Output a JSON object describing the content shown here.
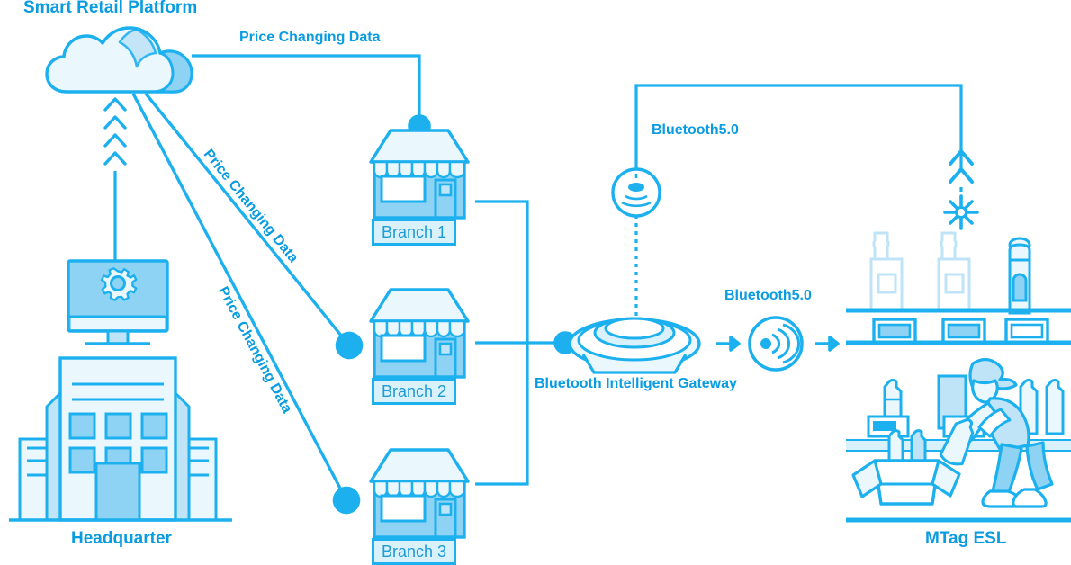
{
  "diagram": {
    "title": "Smart Retail Platform",
    "colors": {
      "accent": "#0a9ce0",
      "stroke": "#1cb0ef",
      "fill_light": "#eaf7fc",
      "fill_mid": "#bfe4f7",
      "fill_deep": "#8fd3f4",
      "label_text": "#1e9ad6",
      "label_bg": "#d8f1fb",
      "background": "#ffffff"
    },
    "nodes": {
      "cloud": {
        "label": "Smart Retail Platform",
        "icon": "cloud-icon"
      },
      "headquarter": {
        "label": "Headquarter",
        "icon": "office-building-icon",
        "monitor_icon": "gear-icon"
      },
      "branch1": {
        "label": "Branch 1",
        "icon": "storefront-icon"
      },
      "branch2": {
        "label": "Branch 2",
        "icon": "storefront-icon"
      },
      "branch3": {
        "label": "Branch 3",
        "icon": "storefront-icon"
      },
      "gateway": {
        "label": "Bluetooth Intelligent Gateway",
        "icon": "gateway-dish-icon"
      },
      "access_point": {
        "icon": "broadcast-circle-icon"
      },
      "signal_relay": {
        "icon": "signal-waves-circle-icon"
      },
      "shelf": {
        "label": "MTag ESL",
        "icon": "retail-shelf-icon"
      },
      "starburst": {
        "icon": "starburst-icon"
      },
      "chevrons_up": {
        "icon": "chevron-up-arrows-icon"
      }
    },
    "connections": [
      {
        "label": "Price Changing Data",
        "from": "cloud",
        "to": "branch1",
        "orientation": "horizontal"
      },
      {
        "label": "Price Changing Data",
        "from": "cloud",
        "to": "branch2",
        "orientation": "diagonal"
      },
      {
        "label": "Price Changing Data",
        "from": "cloud",
        "to": "branch3",
        "orientation": "diagonal"
      },
      {
        "label": "Bluetooth5.0",
        "from": "access-point",
        "to": "shelf",
        "orientation": "top-bus"
      },
      {
        "label": "Bluetooth5.0",
        "from": "gateway",
        "to": "shelf",
        "orientation": "horizontal"
      }
    ],
    "labels": {
      "platform": "Smart Retail Platform",
      "price_data_top": "Price Changing Data",
      "price_data_mid": "Price Changing Data",
      "price_data_low": "Price Changing Data",
      "bluetooth_top": "Bluetooth5.0",
      "bluetooth_mid": "Bluetooth5.0",
      "gateway": "Bluetooth Intelligent Gateway",
      "headquarter": "Headquarter",
      "esl": "MTag ESL",
      "branch1": "Branch 1",
      "branch2": "Branch 2",
      "branch3": "Branch 3"
    }
  }
}
